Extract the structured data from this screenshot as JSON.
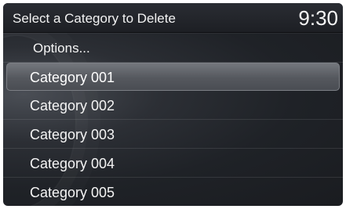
{
  "header": {
    "title": "Select a Category to Delete",
    "clock": "9:30"
  },
  "menu": {
    "options_label": "Options...",
    "items": [
      {
        "label": "Category 001",
        "selected": true
      },
      {
        "label": "Category 002",
        "selected": false
      },
      {
        "label": "Category 003",
        "selected": false
      },
      {
        "label": "Category 004",
        "selected": false
      },
      {
        "label": "Category 005",
        "selected": false
      }
    ]
  },
  "colors": {
    "background": "#1f2227",
    "text": "#f4f4f4",
    "highlight": "#5f6268"
  }
}
